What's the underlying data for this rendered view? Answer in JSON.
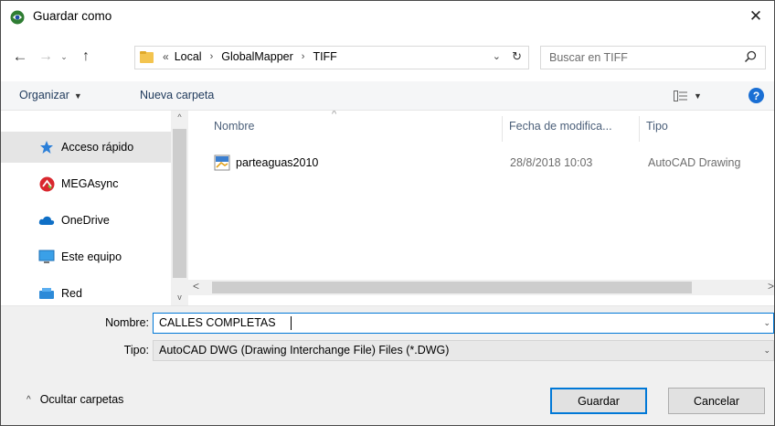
{
  "window": {
    "title": "Guardar como",
    "close_glyph": "✕"
  },
  "nav": {
    "back_glyph": "←",
    "forward_glyph": "→",
    "recent_glyph": "⌄",
    "up_glyph": "↑",
    "address": {
      "overflow": "«",
      "crumbs": [
        "Local",
        "GlobalMapper",
        "TIFF"
      ],
      "separator": "›",
      "dropdown_glyph": "⌄",
      "refresh_glyph": "↻"
    },
    "search_placeholder": "Buscar en TIFF"
  },
  "cmdbar": {
    "organize_label": "Organizar",
    "organize_caret": "▼",
    "new_folder_label": "Nueva carpeta",
    "view_caret": "▼",
    "help_glyph": "?"
  },
  "navpane": {
    "items": [
      {
        "label": "Acceso rápido",
        "icon": "star-icon"
      },
      {
        "label": "MEGAsync",
        "icon": "mega-icon"
      },
      {
        "label": "OneDrive",
        "icon": "cloud-icon"
      },
      {
        "label": "Este equipo",
        "icon": "computer-icon"
      },
      {
        "label": "Red",
        "icon": "network-icon"
      }
    ],
    "scroll_up": "^",
    "scroll_down": "v"
  },
  "filelist": {
    "columns": {
      "name": "Nombre",
      "date": "Fecha de modifica...",
      "type": "Tipo"
    },
    "sort_glyph": "^",
    "rows": [
      {
        "name": "parteaguas2010",
        "date": "28/8/2018 10:03",
        "type": "AutoCAD Drawing",
        "icon": "dwg-file-icon"
      }
    ],
    "scroll_left": "<",
    "scroll_right": ">"
  },
  "form": {
    "name_label": "Nombre:",
    "name_value": "CALLES COMPLETAS",
    "type_label": "Tipo:",
    "type_value": "AutoCAD DWG (Drawing Interchange File) Files (*.DWG)",
    "dropdown_glyph": "⌄"
  },
  "footer": {
    "hide_folders_chev": "^",
    "hide_folders_label": "Ocultar carpetas",
    "save_label": "Guardar",
    "cancel_label": "Cancelar"
  },
  "colors": {
    "accent": "#0078d7",
    "help": "#1a6fd4",
    "selected_nav": "#e5e5e5",
    "folder": "#f3c44f"
  }
}
